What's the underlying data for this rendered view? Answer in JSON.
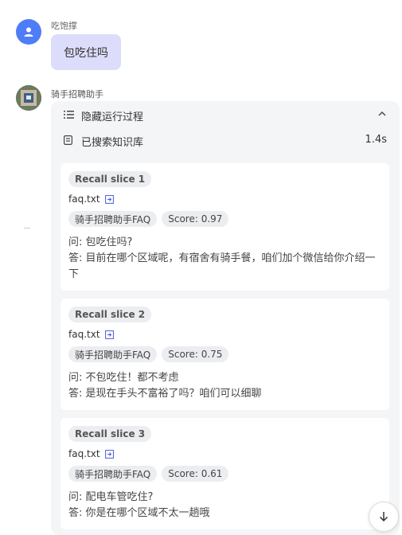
{
  "user": {
    "name": "吃饱撑",
    "message": "包吃住吗"
  },
  "bot": {
    "name": "骑手招聘助手"
  },
  "process": {
    "toggle_label": "隐藏运行过程",
    "search_label": "已搜索知识库",
    "search_time": "1.4s"
  },
  "results": [
    {
      "slice": "Recall slice 1",
      "file": "faq.txt",
      "source": "骑手招聘助手FAQ",
      "score": "Score: 0.97",
      "q": "问: 包吃住吗?",
      "a": "答: 目前在哪个区域呢，有宿舍有骑手餐，咱们加个微信给你介绍一下"
    },
    {
      "slice": "Recall slice 2",
      "file": "faq.txt",
      "source": "骑手招聘助手FAQ",
      "score": "Score: 0.75",
      "q": "问: 不包吃住！都不考虑",
      "a": "答: 是现在手头不富裕了吗？咱们可以细聊"
    },
    {
      "slice": "Recall slice 3",
      "file": "faq.txt",
      "source": "骑手招聘助手FAQ",
      "score": "Score: 0.61",
      "q": "问: 配电车管吃住?",
      "a": "答: 你是在哪个区域不太一趟哦"
    }
  ],
  "icons": {
    "user_avatar": "user-icon",
    "toggle": "list-icon",
    "collapse": "chevron-up-icon",
    "search": "document-icon",
    "file_link": "external-link-icon",
    "scroll": "arrow-down-icon"
  },
  "colors": {
    "accent": "#4f7cf7",
    "user_bubble": "#dcdcfb",
    "panel_bg": "#f4f5f7"
  }
}
